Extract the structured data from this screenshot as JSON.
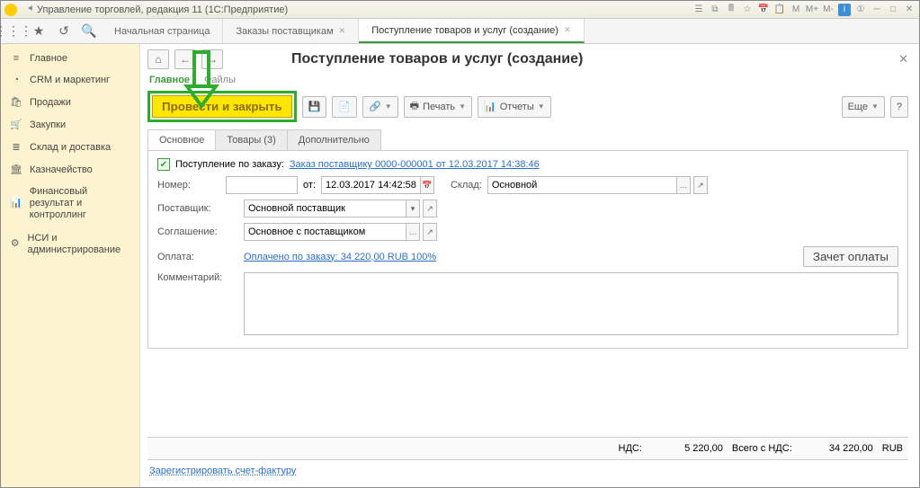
{
  "titlebar": {
    "text": "Управление торговлей, редакция 11  (1С:Предприятие)"
  },
  "tabs": [
    {
      "label": "Начальная страница"
    },
    {
      "label": "Заказы поставщикам"
    },
    {
      "label": "Поступление товаров и услуг (создание)"
    }
  ],
  "sidebar": [
    {
      "icon": "≡",
      "label": "Главное"
    },
    {
      "icon": "◔",
      "label": "CRM и маркетинг"
    },
    {
      "icon": "🛍",
      "label": "Продажи"
    },
    {
      "icon": "🛒",
      "label": "Закупки"
    },
    {
      "icon": "≣",
      "label": "Склад и доставка"
    },
    {
      "icon": "🏛",
      "label": "Казначейство"
    },
    {
      "icon": "📊",
      "label": "Финансовый результат и контроллинг"
    },
    {
      "icon": "⚙",
      "label": "НСИ и администрирование"
    }
  ],
  "page": {
    "title": "Поступление товаров и услуг (создание)"
  },
  "subtabs": {
    "main": "Главное",
    "files": "Файлы"
  },
  "toolbar": {
    "postClose": "Провести и закрыть",
    "print": "Печать",
    "reports": "Отчеты",
    "more": "Еще"
  },
  "innertabs": {
    "main": "Основное",
    "goods": "Товары (3)",
    "extra": "Дополнительно"
  },
  "form": {
    "orderLabel": "Поступление по заказу:",
    "orderLink": "Заказ поставщику 0000-000001 от 12.03.2017 14:38:46",
    "numberLabel": "Номер:",
    "numberValue": "",
    "fromLabel": "от:",
    "dateValue": "12.03.2017 14:42:58",
    "warehouseLabel": "Склад:",
    "warehouseValue": "Основной",
    "supplierLabel": "Поставщик:",
    "supplierValue": "Основной поставщик",
    "agreementLabel": "Соглашение:",
    "agreementValue": "Основное с поставщиком",
    "paymentLabel": "Оплата:",
    "paymentLink": "Оплачено по заказу: 34 220,00 RUB  100%",
    "offsetBtn": "Зачет оплаты",
    "commentLabel": "Комментарий:"
  },
  "totals": {
    "vatLabel": "НДС:",
    "vatValue": "5 220,00",
    "totalLabel": "Всего с НДС:",
    "totalValue": "34 220,00",
    "currency": "RUB"
  },
  "footerLink": "Зарегистрировать счет-фактуру"
}
